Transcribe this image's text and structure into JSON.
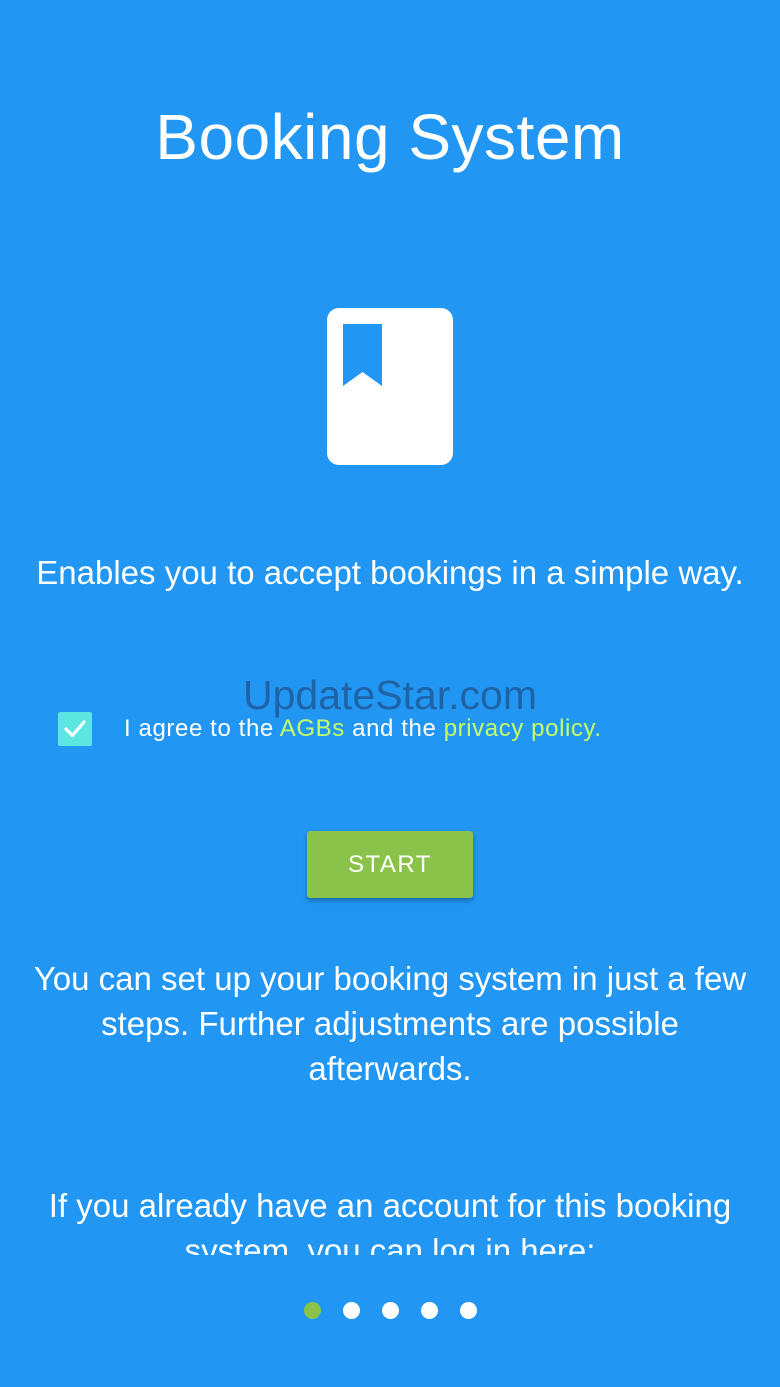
{
  "app": {
    "title": "Booking System",
    "icon": "bookmark-book-icon"
  },
  "intro": {
    "tagline": "Enables you to accept bookings in a simple way."
  },
  "watermark": "UpdateStar.com",
  "agreement": {
    "checked": true,
    "prefix": "I agree to the ",
    "agb_link": "AGBs",
    "middle": " and the ",
    "privacy_link": "privacy policy."
  },
  "start_button": {
    "label": "START"
  },
  "setup": {
    "text": "You can set up your booking system in just a few steps. Further adjustments are possible afterwards."
  },
  "login": {
    "text": "If you already have an account for this booking system, you can log in here:"
  },
  "pager": {
    "count": 5,
    "active_index": 0
  },
  "colors": {
    "background": "#2196F3",
    "accent_green": "#8BC34A",
    "checkbox": "#5CE6E0",
    "link": "#C6FF6A"
  }
}
